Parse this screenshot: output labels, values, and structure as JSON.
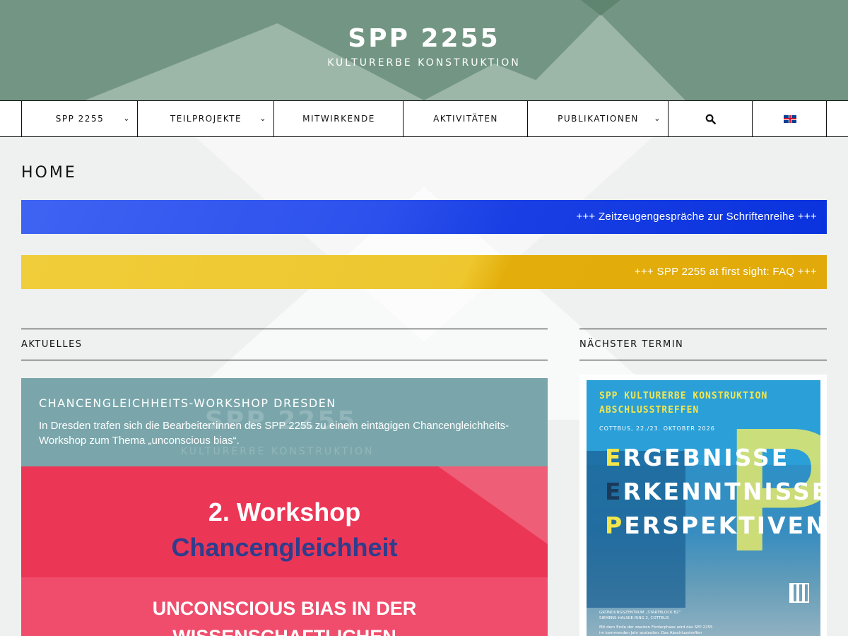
{
  "header": {
    "logo_title": "SPP 2255",
    "logo_subtitle": "KULTURERBE KONSTRUKTION",
    "bg_color": "#739584"
  },
  "nav": {
    "items": [
      {
        "label": "SPP 2255",
        "has_dropdown": true
      },
      {
        "label": "TEILPROJEKTE",
        "has_dropdown": true
      },
      {
        "label": "MITWIRKENDE",
        "has_dropdown": false
      },
      {
        "label": "AKTIVITÄTEN",
        "has_dropdown": false
      },
      {
        "label": "PUBLIKATIONEN",
        "has_dropdown": true
      }
    ],
    "search_icon": "search-icon",
    "language_icon": "uk-flag-icon"
  },
  "page": {
    "title": "HOME"
  },
  "banners": [
    {
      "text": "+++ Zeitzeugengespräche zur Schriftenreihe +++",
      "color": "#2c50ec"
    },
    {
      "text": "+++ SPP 2255 at first sight: FAQ +++",
      "color": "#eec72f"
    }
  ],
  "news": {
    "heading": "AKTUELLES",
    "title": "CHANCENGLEICHHEITS-WORKSHOP DRESDEN",
    "text": "In Dresden trafen sich die Bearbeiter*innen des SPP 2255 zu einem eintägigen Chancengleichheits-Workshop zum Thema „unconscious bias“.",
    "ghost_title": "SPP 2255",
    "ghost_subtitle": "KULTURERBE KONSTRUKTION",
    "image": {
      "line1": "2. Workshop",
      "line2": "Chancengleichheit",
      "line3": "UNCONSCIOUS BIAS IN DER",
      "line4": "WISSENSCHAFTLICHEN"
    }
  },
  "termin": {
    "heading": "NÄCHSTER TERMIN",
    "poster": {
      "line1": "SPP KULTURERBE KONSTRUKTION",
      "line2": "ABSCHLUSSTREFFEN",
      "date": "COTTBUS, 22./23. OKTOBER 2026",
      "word1_first": "E",
      "word1_rest": "RGEBNISSE",
      "word2_first": "E",
      "word2_rest": "RKENNTNISSE",
      "word3_first": "P",
      "word3_rest": "ERSPEKTIVEN",
      "venue1": "GRÜNDUNGSZENTRUM „STARTBLOCK B2“",
      "venue2": "SIEMENS-HALSKE-RING 2, COTTBUS",
      "footer1": "Mit dem Ende der zweiten Förderphase wird das SPP 2255",
      "footer2": "im kommenden Jahr auslaufen. Das Abschlusstreffen"
    }
  }
}
